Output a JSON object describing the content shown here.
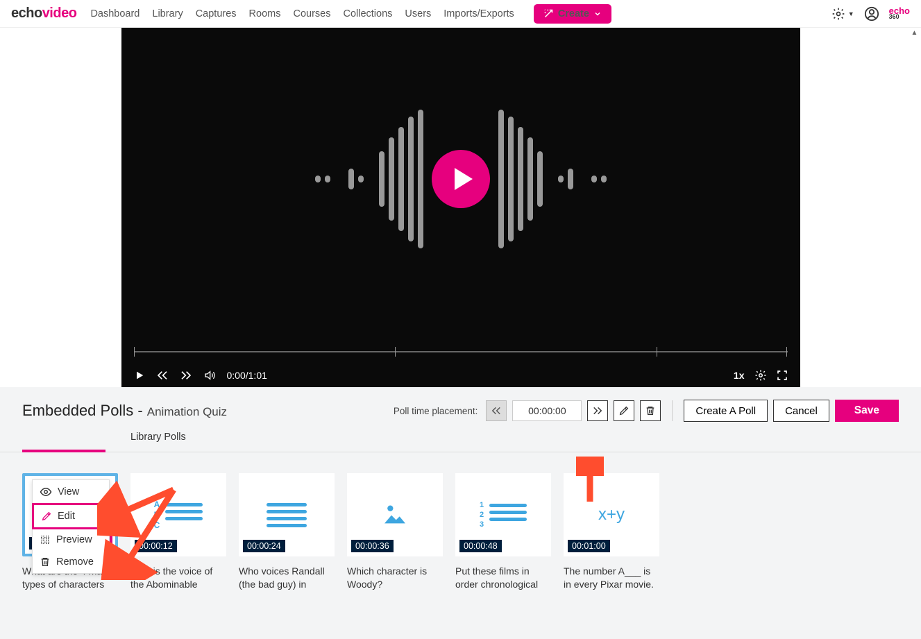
{
  "logo": {
    "a": "echo",
    "b": "video"
  },
  "nav": [
    "Dashboard",
    "Library",
    "Captures",
    "Rooms",
    "Courses",
    "Collections",
    "Users",
    "Imports/Exports"
  ],
  "create": "Create",
  "echo_small": {
    "a": "echo",
    "b": "360"
  },
  "player": {
    "time": "0:00/1:01",
    "speed": "1x",
    "zero": "0"
  },
  "panel": {
    "title_a": "Embedded Polls - ",
    "title_b": "Animation Quiz",
    "placement_label": "Poll time placement:",
    "time": "00:00:00",
    "create_poll": "Create A Poll",
    "cancel": "Cancel",
    "save": "Save"
  },
  "tabs": {
    "lib": "Library Polls"
  },
  "ctx": {
    "view": "View",
    "edit": "Edit",
    "preview": "Preview",
    "remove": "Remove"
  },
  "cards": [
    {
      "ts": "00:00:00",
      "cap": "What are the 4 main types of characters"
    },
    {
      "ts": "00:00:12",
      "cap": "Who is the voice of the Abominable"
    },
    {
      "ts": "00:00:24",
      "cap": "Who voices Randall (the bad guy) in"
    },
    {
      "ts": "00:00:36",
      "cap": "Which character is Woody?"
    },
    {
      "ts": "00:00:48",
      "cap": "Put these films in order chronological"
    },
    {
      "ts": "00:01:00",
      "cap": "The number A___ is in every Pixar movie."
    }
  ]
}
